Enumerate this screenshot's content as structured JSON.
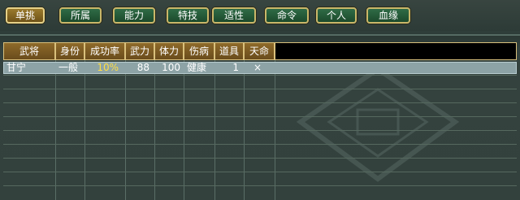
{
  "tabs": [
    {
      "label": "单挑",
      "active": true
    },
    {
      "label": "所属",
      "active": false
    },
    {
      "label": "能力",
      "active": false
    },
    {
      "label": "特技",
      "active": false
    },
    {
      "label": "适性",
      "active": false
    },
    {
      "label": "命令",
      "active": false
    },
    {
      "label": "个人",
      "active": false
    },
    {
      "label": "血缘",
      "active": false
    }
  ],
  "table": {
    "columns": [
      "武将",
      "身份",
      "成功率",
      "武力",
      "体力",
      "伤病",
      "道具",
      "天命"
    ],
    "rows": [
      {
        "name": "甘宁",
        "status": "一般",
        "success_rate": "10%",
        "strength": "88",
        "stamina": "100",
        "injury": "健康",
        "items": "1",
        "destiny": "×"
      }
    ]
  },
  "colors": {
    "tab_active": "#9a7a2c",
    "tab_normal": "#2f6b46",
    "header": "#8e6a2a",
    "row_selected": "#8da3a6",
    "success_rate_text": "#ffdd44"
  }
}
